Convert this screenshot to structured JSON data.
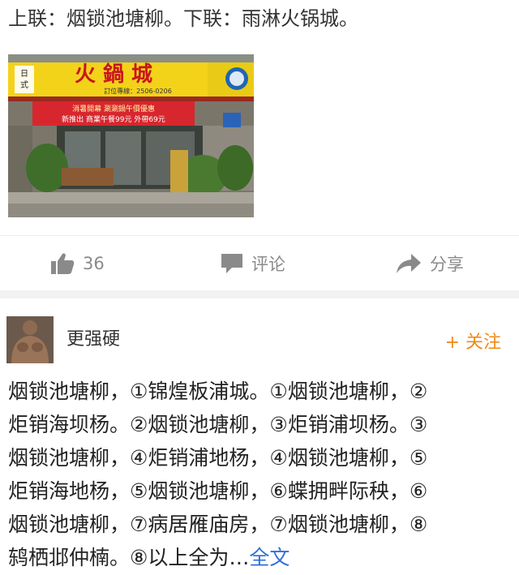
{
  "post": {
    "text": "上联：烟锁池塘柳。下联：雨淋火锅城。",
    "image_sign": {
      "small_label_top": "日",
      "small_label_bottom": "式",
      "name": "火 鍋 城",
      "phone": "訂位專線：2506-0206",
      "banner": "消暑開幕 涮涮鍋午價優惠",
      "banner_sub": "新推出 商業午餐99元 外帶69元"
    }
  },
  "actions": {
    "like_count": "36",
    "comment_label": "评论",
    "share_label": "分享"
  },
  "comment": {
    "username": "更强硬",
    "follow_label": "+ 关注",
    "lines": [
      "烟锁池塘柳，①锦煌板浦城。①烟锁池塘柳，②",
      "炬销海坝杨。②烟锁池塘柳，③炬销浦坝杨。③",
      "烟锁池塘柳，④炬销浦地杨，④烟锁池塘柳，⑤",
      "炬销海地杨，⑤烟锁池塘柳，⑥蝶拥畔际秧，⑥",
      "烟锁池塘柳，⑦病居雁庙房，⑦烟锁池塘柳，⑧"
    ],
    "last_line": "鸫栖邶仲楠。⑧以上全为…",
    "more_label": "全文"
  },
  "colors": {
    "follow": "#f08a1a",
    "link": "#2e6fd8",
    "muted": "#8a8a8a",
    "sign_yellow": "#f3d21a",
    "banner_red": "#d8262e"
  }
}
